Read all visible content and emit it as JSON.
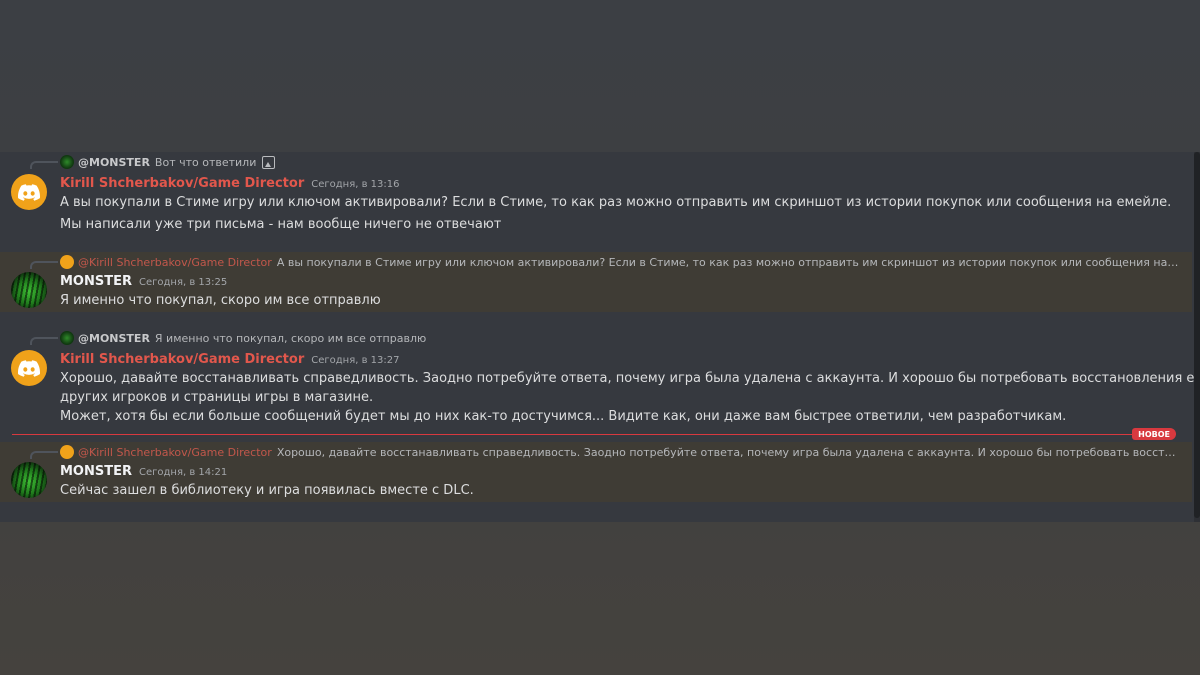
{
  "messages": [
    {
      "reply": {
        "author": "@MONSTER",
        "text": "Вот что ответили",
        "attachment_icon": "image-icon"
      },
      "author": "Kirill Shcherbakov/Game Director",
      "time": "Сегодня, в 13:16",
      "lines": [
        "А вы покупали в Стиме игру или ключом активировали? Если в Стиме, то как раз можно отправить им скриншот из истории покупок или сообщения на емейле.",
        "Мы написали уже три письма - нам вообще ничего не отвечают"
      ]
    },
    {
      "reply": {
        "author": "@Kirill Shcherbakov/Game Director",
        "text": "А вы покупали в Стиме игру или ключом активировали? Если в Стиме, то как раз можно отправить им скриншот из истории покупок или сообщения на емейле."
      },
      "author": "MONSTER",
      "time": "Сегодня, в 13:25",
      "lines": [
        "Я именно что покупал, скоро им все отправлю"
      ]
    },
    {
      "reply": {
        "author": "@MONSTER",
        "text": "Я именно что покупал, скоро им все отправлю"
      },
      "author": "Kirill Shcherbakov/Game Director",
      "time": "Сегодня, в 13:27",
      "lines": [
        "Хорошо, давайте восстанавливать справедливость. Заодно потребуйте ответа, почему игра была удалена с аккаунта. И хорошо бы потребовать восстановления её на аккаунтах",
        "других игроков и страницы игры в магазине.",
        "Может, хотя бы если больше сообщений будет мы до них как-то достучимся... Видите как, они даже вам быстрее ответили, чем разработчикам."
      ]
    },
    {
      "reply": {
        "author": "@Kirill Shcherbakov/Game Director",
        "text": "Хорошо, давайте восстанавливать справедливость. Заодно потребуйте ответа, почему игра была удалена с аккаунта. И хорошо бы потребовать восстановления её ..."
      },
      "author": "MONSTER",
      "time": "Сегодня, в 14:21",
      "lines": [
        "Сейчас зашел в библиотеку и игра появилась вместе с DLC."
      ]
    }
  ],
  "divider": {
    "label": "НОВОЕ"
  },
  "colors": {
    "accent_red": "#e2574c",
    "discord_avatar": "#f0a21a",
    "mention_bg": "#3f3c35",
    "background": "#36393f"
  }
}
